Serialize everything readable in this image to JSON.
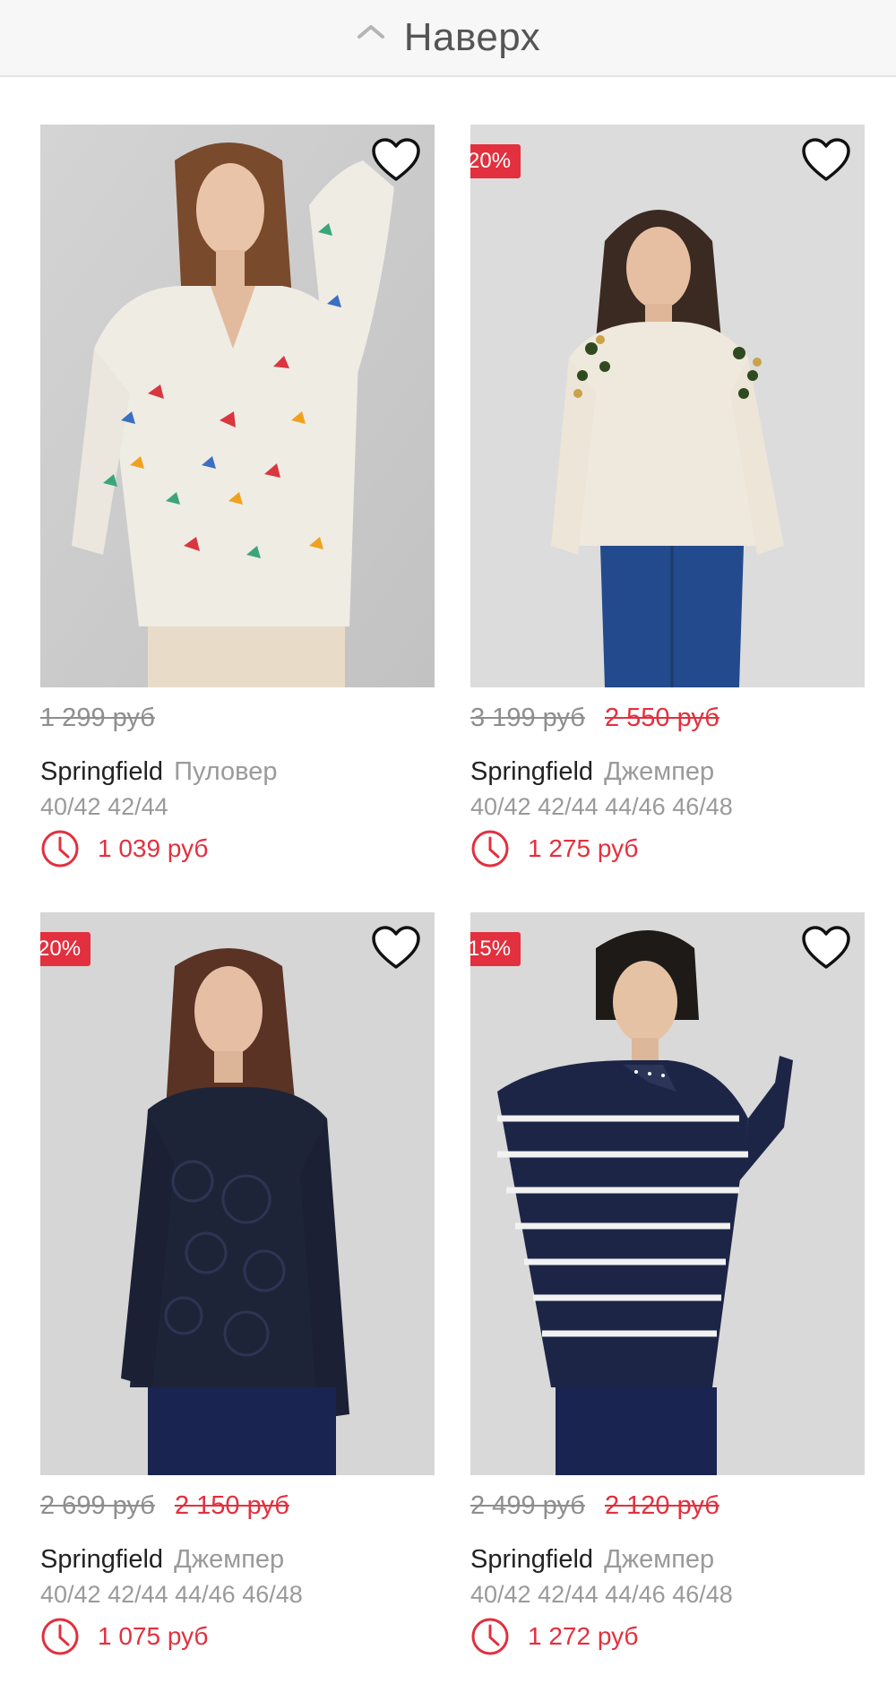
{
  "header": {
    "back_to_top_label": "Наверх"
  },
  "colors": {
    "accent": "#e2303e",
    "muted": "#9a9a9a",
    "strike": "#8e8e8e"
  },
  "products": [
    {
      "badge": "",
      "old_price": "1 299 руб",
      "mid_price": "",
      "brand": "Springfield",
      "kind": "Пуловер",
      "sizes": "40/42 42/44",
      "final_price": "1 039 руб",
      "image": "model-butterfly-sweater"
    },
    {
      "badge": "-20%",
      "old_price": "3 199 руб",
      "mid_price": "2 550 руб",
      "brand": "Springfield",
      "kind": "Джемпер",
      "sizes": "40/42 42/44 44/46 46/48",
      "final_price": "1 275 руб",
      "image": "model-cream-embellished-sweater"
    },
    {
      "badge": "-20%",
      "old_price": "2 699 руб",
      "mid_price": "2 150 руб",
      "brand": "Springfield",
      "kind": "Джемпер",
      "sizes": "40/42 42/44 44/46 46/48",
      "final_price": "1 075 руб",
      "image": "model-navy-lace-sweater"
    },
    {
      "badge": "-15%",
      "old_price": "2 499 руб",
      "mid_price": "2 120 руб",
      "brand": "Springfield",
      "kind": "Джемпер",
      "sizes": "40/42 42/44 44/46 46/48",
      "final_price": "1 272 руб",
      "image": "model-navy-striped-sweater"
    }
  ]
}
